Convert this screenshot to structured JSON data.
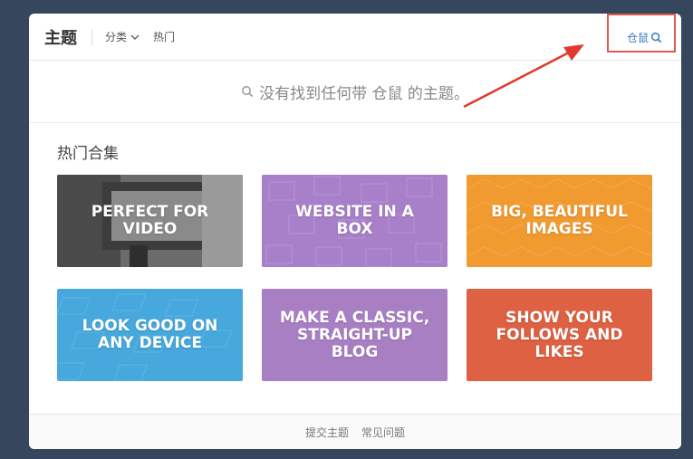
{
  "header": {
    "title": "主题",
    "nav_category": "分类",
    "nav_hot": "热门",
    "search_query": "仓鼠"
  },
  "empty_state": {
    "message": "没有找到任何带 仓鼠 的主题。"
  },
  "collections": {
    "heading": "热门合集",
    "cards": [
      {
        "label": "PERFECT FOR VIDEO",
        "color": "#5a5a5a"
      },
      {
        "label": "WEBSITE IN A BOX",
        "color": "#a87fc9"
      },
      {
        "label": "BIG, BEAUTIFUL IMAGES",
        "color": "#f09a30"
      },
      {
        "label": "LOOK GOOD ON ANY DEVICE",
        "color": "#46a8dc"
      },
      {
        "label": "MAKE A CLASSIC, STRAIGHT-UP BLOG",
        "color": "#a97fc4"
      },
      {
        "label": "SHOW YOUR FOLLOWS AND LIKES",
        "color": "#dd6142"
      }
    ]
  },
  "footer": {
    "submit": "提交主题",
    "faq": "常见问题"
  },
  "colors": {
    "background": "#36465d",
    "highlight": "#e05a4c",
    "link": "#3a7abf"
  }
}
